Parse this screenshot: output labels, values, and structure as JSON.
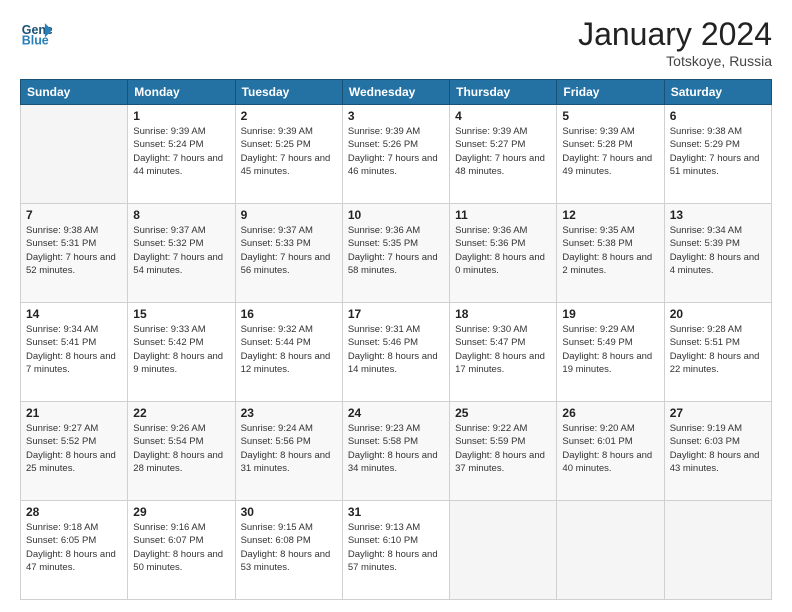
{
  "header": {
    "logo_line1": "General",
    "logo_line2": "Blue",
    "month_title": "January 2024",
    "location": "Totskoye, Russia"
  },
  "columns": [
    "Sunday",
    "Monday",
    "Tuesday",
    "Wednesday",
    "Thursday",
    "Friday",
    "Saturday"
  ],
  "weeks": [
    [
      {
        "day": "",
        "sunrise": "",
        "sunset": "",
        "daylight": ""
      },
      {
        "day": "1",
        "sunrise": "Sunrise: 9:39 AM",
        "sunset": "Sunset: 5:24 PM",
        "daylight": "Daylight: 7 hours and 44 minutes."
      },
      {
        "day": "2",
        "sunrise": "Sunrise: 9:39 AM",
        "sunset": "Sunset: 5:25 PM",
        "daylight": "Daylight: 7 hours and 45 minutes."
      },
      {
        "day": "3",
        "sunrise": "Sunrise: 9:39 AM",
        "sunset": "Sunset: 5:26 PM",
        "daylight": "Daylight: 7 hours and 46 minutes."
      },
      {
        "day": "4",
        "sunrise": "Sunrise: 9:39 AM",
        "sunset": "Sunset: 5:27 PM",
        "daylight": "Daylight: 7 hours and 48 minutes."
      },
      {
        "day": "5",
        "sunrise": "Sunrise: 9:39 AM",
        "sunset": "Sunset: 5:28 PM",
        "daylight": "Daylight: 7 hours and 49 minutes."
      },
      {
        "day": "6",
        "sunrise": "Sunrise: 9:38 AM",
        "sunset": "Sunset: 5:29 PM",
        "daylight": "Daylight: 7 hours and 51 minutes."
      }
    ],
    [
      {
        "day": "7",
        "sunrise": "Sunrise: 9:38 AM",
        "sunset": "Sunset: 5:31 PM",
        "daylight": "Daylight: 7 hours and 52 minutes."
      },
      {
        "day": "8",
        "sunrise": "Sunrise: 9:37 AM",
        "sunset": "Sunset: 5:32 PM",
        "daylight": "Daylight: 7 hours and 54 minutes."
      },
      {
        "day": "9",
        "sunrise": "Sunrise: 9:37 AM",
        "sunset": "Sunset: 5:33 PM",
        "daylight": "Daylight: 7 hours and 56 minutes."
      },
      {
        "day": "10",
        "sunrise": "Sunrise: 9:36 AM",
        "sunset": "Sunset: 5:35 PM",
        "daylight": "Daylight: 7 hours and 58 minutes."
      },
      {
        "day": "11",
        "sunrise": "Sunrise: 9:36 AM",
        "sunset": "Sunset: 5:36 PM",
        "daylight": "Daylight: 8 hours and 0 minutes."
      },
      {
        "day": "12",
        "sunrise": "Sunrise: 9:35 AM",
        "sunset": "Sunset: 5:38 PM",
        "daylight": "Daylight: 8 hours and 2 minutes."
      },
      {
        "day": "13",
        "sunrise": "Sunrise: 9:34 AM",
        "sunset": "Sunset: 5:39 PM",
        "daylight": "Daylight: 8 hours and 4 minutes."
      }
    ],
    [
      {
        "day": "14",
        "sunrise": "Sunrise: 9:34 AM",
        "sunset": "Sunset: 5:41 PM",
        "daylight": "Daylight: 8 hours and 7 minutes."
      },
      {
        "day": "15",
        "sunrise": "Sunrise: 9:33 AM",
        "sunset": "Sunset: 5:42 PM",
        "daylight": "Daylight: 8 hours and 9 minutes."
      },
      {
        "day": "16",
        "sunrise": "Sunrise: 9:32 AM",
        "sunset": "Sunset: 5:44 PM",
        "daylight": "Daylight: 8 hours and 12 minutes."
      },
      {
        "day": "17",
        "sunrise": "Sunrise: 9:31 AM",
        "sunset": "Sunset: 5:46 PM",
        "daylight": "Daylight: 8 hours and 14 minutes."
      },
      {
        "day": "18",
        "sunrise": "Sunrise: 9:30 AM",
        "sunset": "Sunset: 5:47 PM",
        "daylight": "Daylight: 8 hours and 17 minutes."
      },
      {
        "day": "19",
        "sunrise": "Sunrise: 9:29 AM",
        "sunset": "Sunset: 5:49 PM",
        "daylight": "Daylight: 8 hours and 19 minutes."
      },
      {
        "day": "20",
        "sunrise": "Sunrise: 9:28 AM",
        "sunset": "Sunset: 5:51 PM",
        "daylight": "Daylight: 8 hours and 22 minutes."
      }
    ],
    [
      {
        "day": "21",
        "sunrise": "Sunrise: 9:27 AM",
        "sunset": "Sunset: 5:52 PM",
        "daylight": "Daylight: 8 hours and 25 minutes."
      },
      {
        "day": "22",
        "sunrise": "Sunrise: 9:26 AM",
        "sunset": "Sunset: 5:54 PM",
        "daylight": "Daylight: 8 hours and 28 minutes."
      },
      {
        "day": "23",
        "sunrise": "Sunrise: 9:24 AM",
        "sunset": "Sunset: 5:56 PM",
        "daylight": "Daylight: 8 hours and 31 minutes."
      },
      {
        "day": "24",
        "sunrise": "Sunrise: 9:23 AM",
        "sunset": "Sunset: 5:58 PM",
        "daylight": "Daylight: 8 hours and 34 minutes."
      },
      {
        "day": "25",
        "sunrise": "Sunrise: 9:22 AM",
        "sunset": "Sunset: 5:59 PM",
        "daylight": "Daylight: 8 hours and 37 minutes."
      },
      {
        "day": "26",
        "sunrise": "Sunrise: 9:20 AM",
        "sunset": "Sunset: 6:01 PM",
        "daylight": "Daylight: 8 hours and 40 minutes."
      },
      {
        "day": "27",
        "sunrise": "Sunrise: 9:19 AM",
        "sunset": "Sunset: 6:03 PM",
        "daylight": "Daylight: 8 hours and 43 minutes."
      }
    ],
    [
      {
        "day": "28",
        "sunrise": "Sunrise: 9:18 AM",
        "sunset": "Sunset: 6:05 PM",
        "daylight": "Daylight: 8 hours and 47 minutes."
      },
      {
        "day": "29",
        "sunrise": "Sunrise: 9:16 AM",
        "sunset": "Sunset: 6:07 PM",
        "daylight": "Daylight: 8 hours and 50 minutes."
      },
      {
        "day": "30",
        "sunrise": "Sunrise: 9:15 AM",
        "sunset": "Sunset: 6:08 PM",
        "daylight": "Daylight: 8 hours and 53 minutes."
      },
      {
        "day": "31",
        "sunrise": "Sunrise: 9:13 AM",
        "sunset": "Sunset: 6:10 PM",
        "daylight": "Daylight: 8 hours and 57 minutes."
      },
      {
        "day": "",
        "sunrise": "",
        "sunset": "",
        "daylight": ""
      },
      {
        "day": "",
        "sunrise": "",
        "sunset": "",
        "daylight": ""
      },
      {
        "day": "",
        "sunrise": "",
        "sunset": "",
        "daylight": ""
      }
    ]
  ]
}
